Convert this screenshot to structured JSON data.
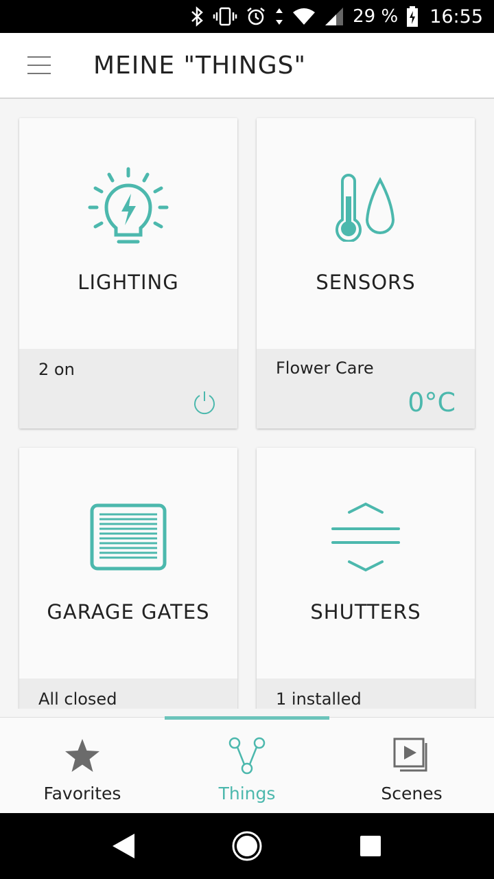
{
  "status_bar": {
    "battery_percent": "29 %",
    "time": "16:55",
    "icons": [
      "bluetooth-icon",
      "vibrate-icon",
      "alarm-icon",
      "data-arrows-icon",
      "wifi-icon",
      "signal-icon",
      "battery-charging-icon"
    ]
  },
  "header": {
    "title": "MEINE \"THINGS\"",
    "menu_icon": "hamburger-menu-icon"
  },
  "cards": [
    {
      "title": "LIGHTING",
      "icon": "lightbulb-icon",
      "subtitle": "2 on",
      "action_icon": "power-icon"
    },
    {
      "title": "SENSORS",
      "icon": "thermometer-drop-icon",
      "subtitle": "Flower Care",
      "value": "0°C"
    },
    {
      "title": "GARAGE GATES",
      "icon": "garage-gate-icon",
      "subtitle": "All closed"
    },
    {
      "title": "SHUTTERS",
      "icon": "shutters-icon",
      "subtitle": "1 installed"
    }
  ],
  "bottom_nav": {
    "items": [
      {
        "label": "Favorites",
        "icon": "star-icon",
        "active": false
      },
      {
        "label": "Things",
        "icon": "things-graph-icon",
        "active": true
      },
      {
        "label": "Scenes",
        "icon": "scenes-play-icon",
        "active": false
      }
    ]
  },
  "system_nav": [
    "back-icon",
    "home-icon",
    "recents-icon"
  ],
  "colors": {
    "accent": "#4cb8ad",
    "status_bar_bg": "#000000",
    "card_footer_bg": "#ececec"
  }
}
